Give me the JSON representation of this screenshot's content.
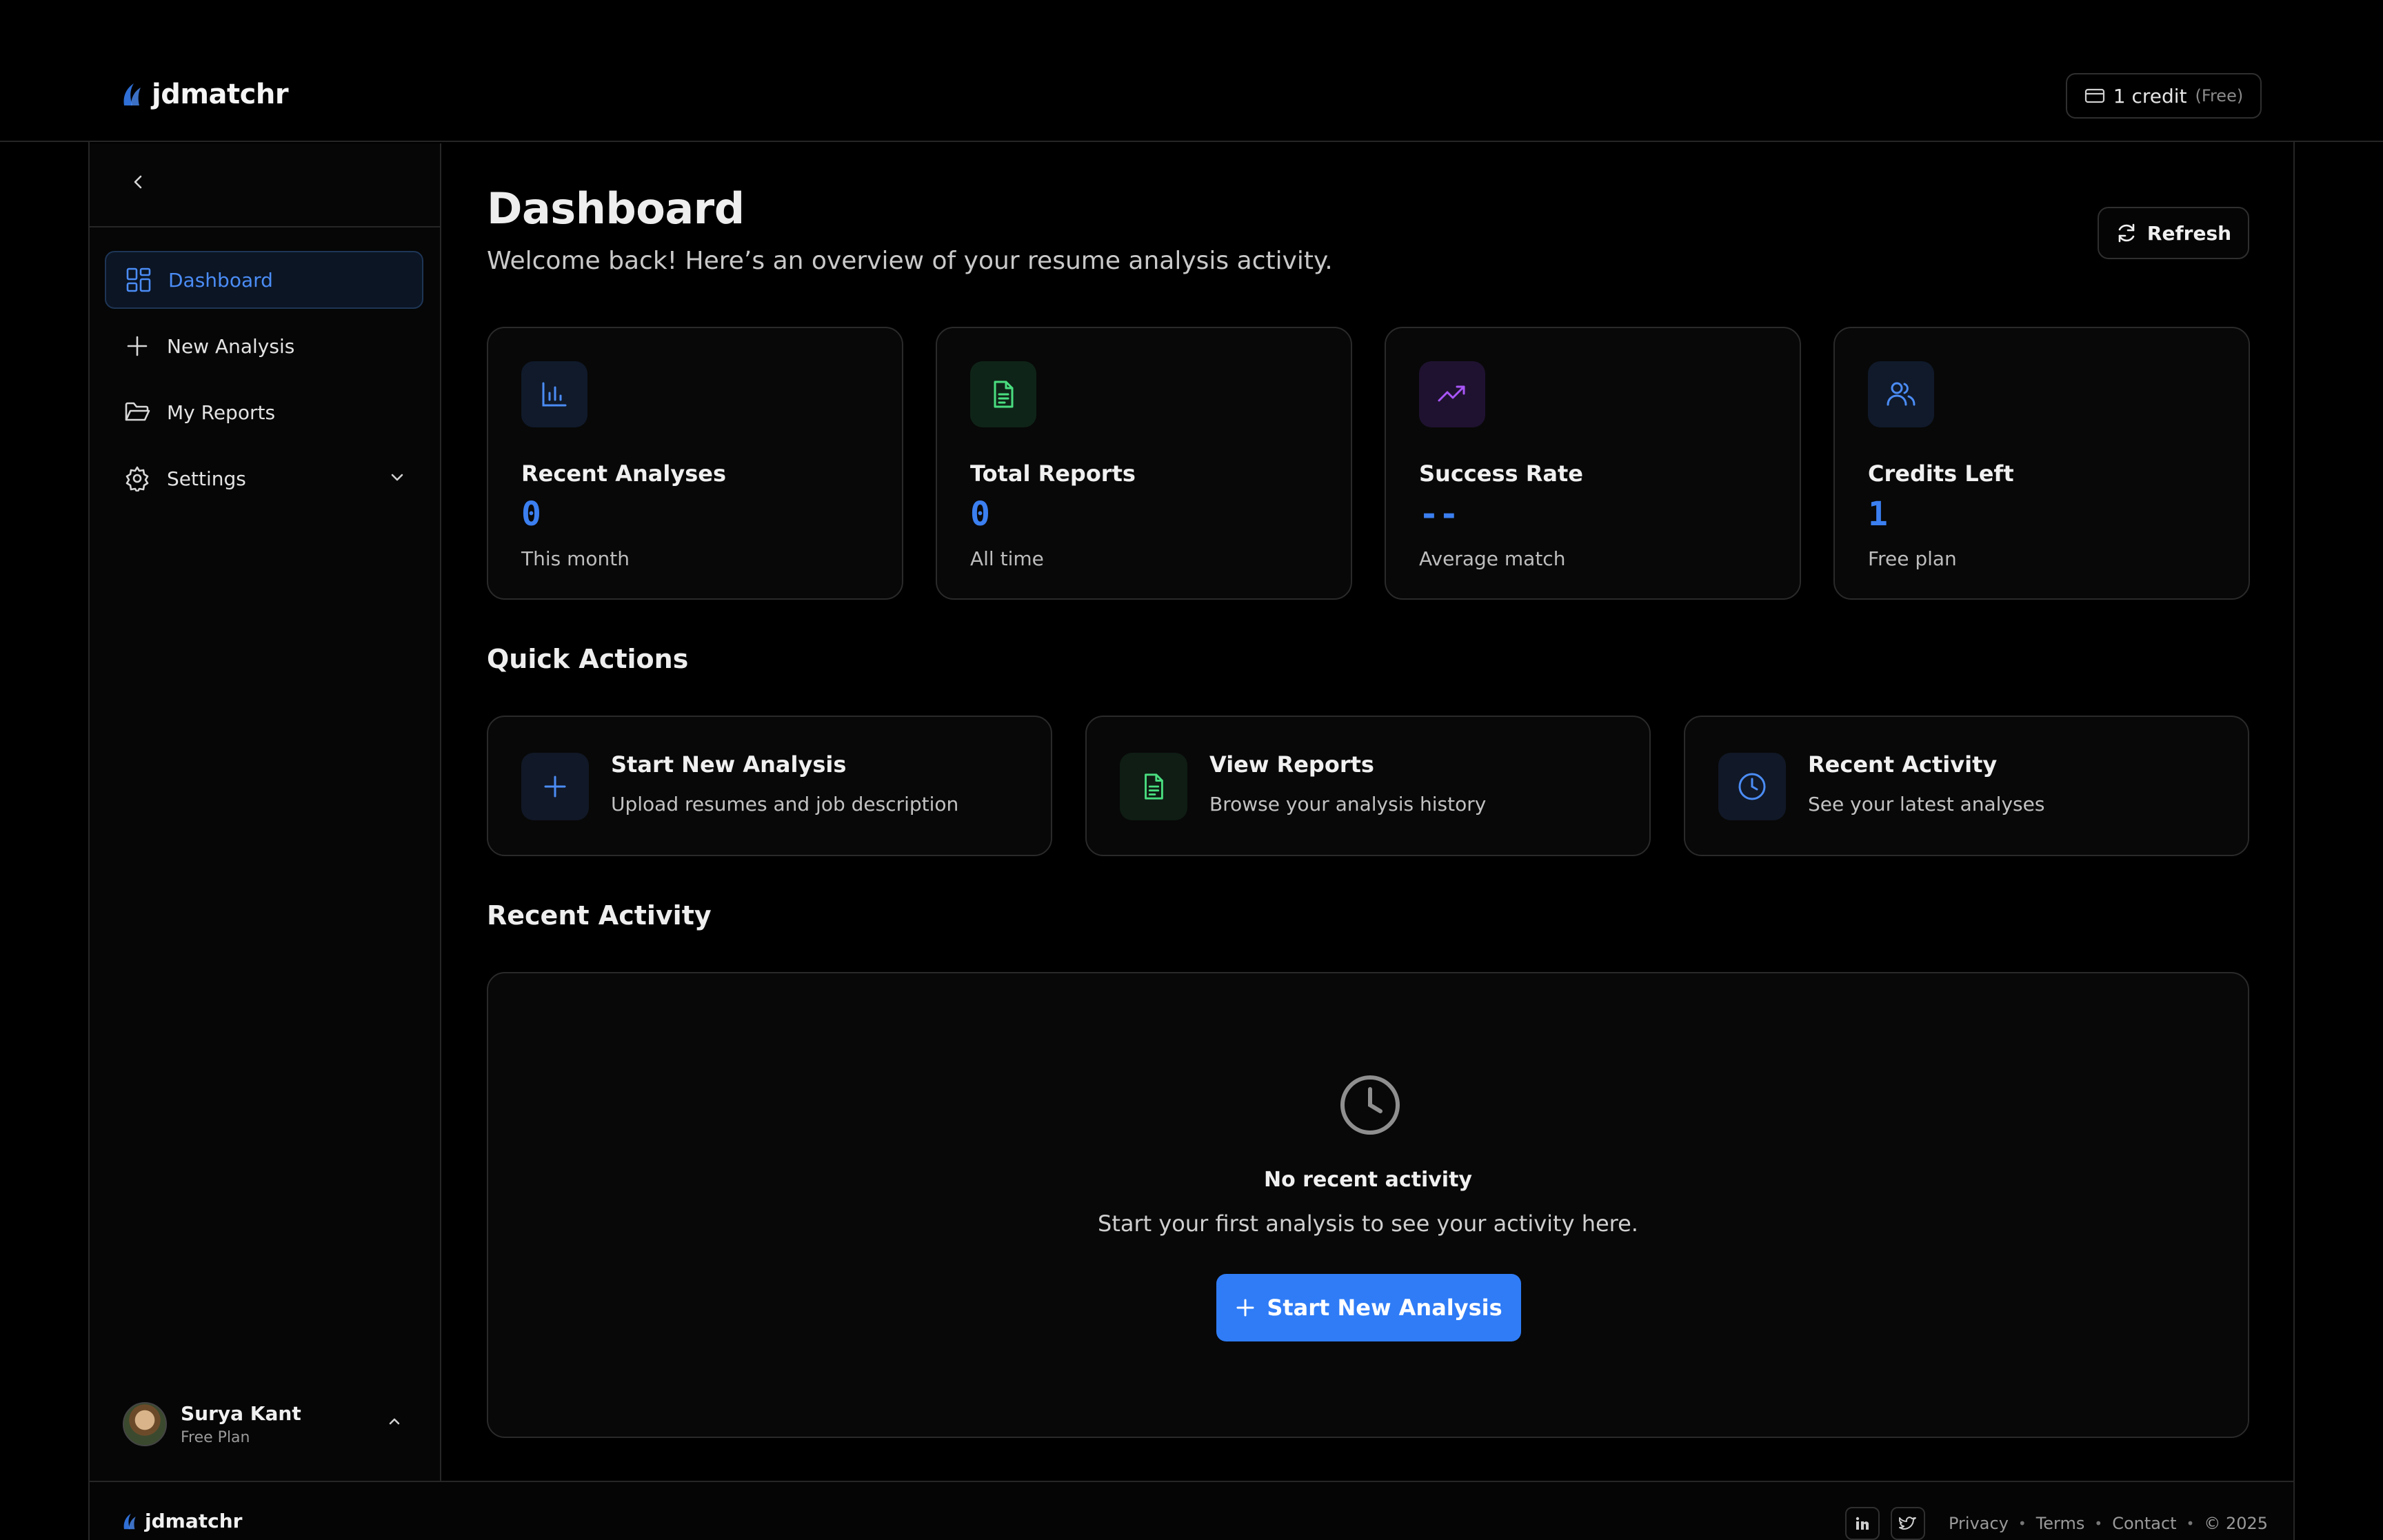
{
  "app": {
    "name": "jdmatchr"
  },
  "header": {
    "credit_amount": "1 credit",
    "credit_plan": "(Free)"
  },
  "sidebar": {
    "items": [
      {
        "label": "Dashboard",
        "icon": "grid-icon",
        "active": true
      },
      {
        "label": "New Analysis",
        "icon": "plus-icon"
      },
      {
        "label": "My Reports",
        "icon": "folder-icon"
      },
      {
        "label": "Settings",
        "icon": "gear-icon",
        "expandable": true
      }
    ],
    "user": {
      "name": "Surya Kant",
      "plan": "Free Plan"
    }
  },
  "main": {
    "title": "Dashboard",
    "subtitle": "Welcome back! Here’s an overview of your resume analysis activity.",
    "refresh_label": "Refresh",
    "stats": [
      {
        "label": "Recent Analyses",
        "value": "0",
        "caption": "This month",
        "icon": "bar-chart-icon",
        "accent": "#4b8cf5"
      },
      {
        "label": "Total Reports",
        "value": "0",
        "caption": "All time",
        "icon": "document-icon",
        "accent": "#4ade80"
      },
      {
        "label": "Success Rate",
        "value": "--",
        "caption": "Average match",
        "icon": "trending-up-icon",
        "accent": "#a855f7"
      },
      {
        "label": "Credits Left",
        "value": "1",
        "caption": "Free plan",
        "icon": "users-icon",
        "accent": "#4b8cf5"
      }
    ],
    "quick_actions_title": "Quick Actions",
    "quick_actions": [
      {
        "title": "Start New Analysis",
        "desc": "Upload resumes and job description",
        "icon": "plus-icon"
      },
      {
        "title": "View Reports",
        "desc": "Browse your analysis history",
        "icon": "document-icon"
      },
      {
        "title": "Recent Activity",
        "desc": "See your latest analyses",
        "icon": "clock-icon"
      }
    ],
    "recent_activity_title": "Recent Activity",
    "empty": {
      "title": "No recent activity",
      "subtitle": "Start your first analysis to see your activity here.",
      "cta": "Start New Analysis"
    }
  },
  "footer": {
    "brand": "jdmatchr",
    "links": [
      "Privacy",
      "Terms",
      "Contact"
    ],
    "copyright": "© 2025"
  },
  "colors": {
    "accent": "#2f7cf6",
    "background": "#000000",
    "card": "#080808"
  }
}
